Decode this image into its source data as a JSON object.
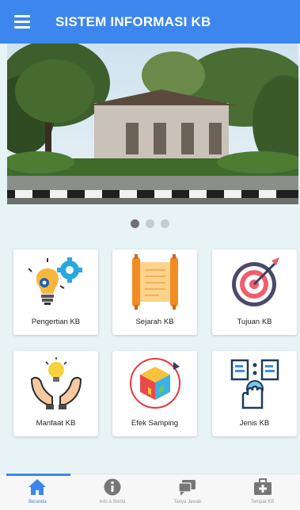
{
  "appbar": {
    "title": "SISTEM INFORMASI KB",
    "menu_icon": "menu-icon",
    "color": "#3d86ee"
  },
  "carousel": {
    "slide_count": 3,
    "active_index": 0
  },
  "menu_cards": [
    {
      "label": "Pengertian KB",
      "icon": "lightbulb-gear-icon"
    },
    {
      "label": "Sejarah KB",
      "icon": "scroll-icon"
    },
    {
      "label": "Tujuan KB",
      "icon": "target-icon"
    },
    {
      "label": "Manfaat KB",
      "icon": "hands-lightbulb-icon"
    },
    {
      "label": "Efek Samping",
      "icon": "cube-icon"
    },
    {
      "label": "Jenis KB",
      "icon": "documents-hand-icon"
    }
  ],
  "bottom_nav": [
    {
      "label": "Beranda",
      "icon": "home-icon",
      "active": true
    },
    {
      "label": "Info & Berita",
      "icon": "info-icon",
      "active": false
    },
    {
      "label": "Tanya Jawab",
      "icon": "chat-icon",
      "active": false
    },
    {
      "label": "Tempat KB",
      "icon": "medkit-icon",
      "active": false
    }
  ]
}
